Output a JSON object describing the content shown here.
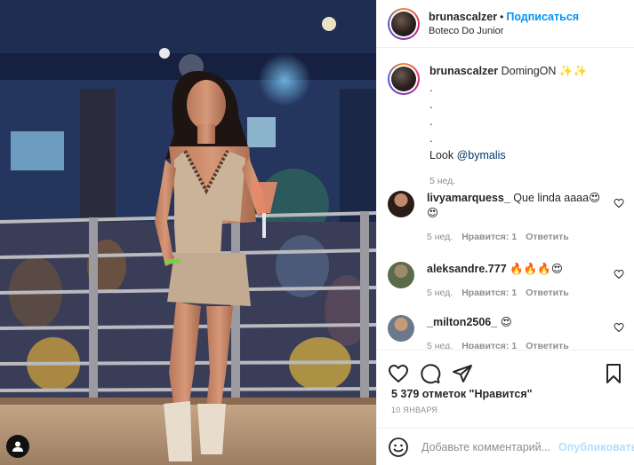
{
  "post": {
    "username": "brunascalzer",
    "follow_label": "Подписаться",
    "location": "Boteco Do Junior"
  },
  "caption": {
    "username": "brunascalzer",
    "text": "DomingON ✨✨",
    "dots": [
      ".",
      ".",
      ".",
      "."
    ],
    "look_prefix": "Look ",
    "mention": "@bymalis",
    "time": "5 нед."
  },
  "comments": [
    {
      "username": "livyamarquess_",
      "text": "Que linda aaaa😍😍",
      "time": "5 нед.",
      "likes": "Нравится: 1",
      "reply": "Ответить"
    },
    {
      "username": "aleksandre.777",
      "text": "🔥🔥🔥😍",
      "time": "5 нед.",
      "likes": "Нравится: 1",
      "reply": "Ответить"
    },
    {
      "username": "_milton2506_",
      "text": "😍",
      "time": "5 нед.",
      "likes": "Нравится: 1",
      "reply": "Ответить"
    }
  ],
  "actions": {
    "like_icon": "heart-icon",
    "comment_icon": "comment-bubble-icon",
    "share_icon": "paper-plane-icon",
    "save_icon": "bookmark-icon"
  },
  "likes_count": "5 379 отметок \"Нравится\"",
  "date": "10 ЯНВАРЯ",
  "add_comment": {
    "placeholder": "Добавьте комментарий...",
    "publish_label": "Опубликовать"
  },
  "colors": {
    "accent": "#0095f6",
    "publish_disabled": "#b2dffc",
    "muted": "#8e8e8e",
    "text": "#262626"
  }
}
